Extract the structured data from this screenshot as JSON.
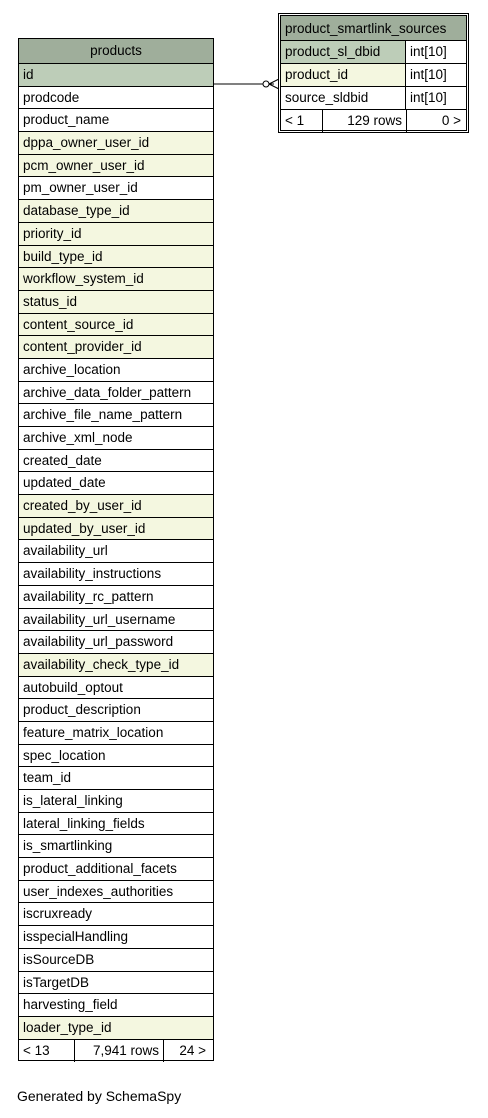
{
  "products": {
    "title": "products",
    "columns": [
      {
        "name": "id",
        "kind": "pk"
      },
      {
        "name": "prodcode",
        "kind": "plain"
      },
      {
        "name": "product_name",
        "kind": "plain"
      },
      {
        "name": "dppa_owner_user_id",
        "kind": "fk"
      },
      {
        "name": "pcm_owner_user_id",
        "kind": "fk"
      },
      {
        "name": "pm_owner_user_id",
        "kind": "plain"
      },
      {
        "name": "database_type_id",
        "kind": "fk"
      },
      {
        "name": "priority_id",
        "kind": "fk"
      },
      {
        "name": "build_type_id",
        "kind": "fk"
      },
      {
        "name": "workflow_system_id",
        "kind": "fk"
      },
      {
        "name": "status_id",
        "kind": "fk"
      },
      {
        "name": "content_source_id",
        "kind": "fk"
      },
      {
        "name": "content_provider_id",
        "kind": "fk"
      },
      {
        "name": "archive_location",
        "kind": "plain"
      },
      {
        "name": "archive_data_folder_pattern",
        "kind": "plain"
      },
      {
        "name": "archive_file_name_pattern",
        "kind": "plain"
      },
      {
        "name": "archive_xml_node",
        "kind": "plain"
      },
      {
        "name": "created_date",
        "kind": "plain"
      },
      {
        "name": "updated_date",
        "kind": "plain"
      },
      {
        "name": "created_by_user_id",
        "kind": "fk"
      },
      {
        "name": "updated_by_user_id",
        "kind": "fk"
      },
      {
        "name": "availability_url",
        "kind": "plain"
      },
      {
        "name": "availability_instructions",
        "kind": "plain"
      },
      {
        "name": "availability_rc_pattern",
        "kind": "plain"
      },
      {
        "name": "availability_url_username",
        "kind": "plain"
      },
      {
        "name": "availability_url_password",
        "kind": "plain"
      },
      {
        "name": "availability_check_type_id",
        "kind": "fk"
      },
      {
        "name": "autobuild_optout",
        "kind": "plain"
      },
      {
        "name": "product_description",
        "kind": "plain"
      },
      {
        "name": "feature_matrix_location",
        "kind": "plain"
      },
      {
        "name": "spec_location",
        "kind": "plain"
      },
      {
        "name": "team_id",
        "kind": "plain"
      },
      {
        "name": "is_lateral_linking",
        "kind": "plain"
      },
      {
        "name": "lateral_linking_fields",
        "kind": "plain"
      },
      {
        "name": "is_smartlinking",
        "kind": "plain"
      },
      {
        "name": "product_additional_facets",
        "kind": "plain"
      },
      {
        "name": "user_indexes_authorities",
        "kind": "plain"
      },
      {
        "name": "iscruxready",
        "kind": "plain"
      },
      {
        "name": "isspecialHandling",
        "kind": "plain"
      },
      {
        "name": "isSourceDB",
        "kind": "plain"
      },
      {
        "name": "isTargetDB",
        "kind": "plain"
      },
      {
        "name": "harvesting_field",
        "kind": "plain"
      },
      {
        "name": "loader_type_id",
        "kind": "fk"
      }
    ],
    "footer": {
      "parents": "< 13",
      "rows": "7,941 rows",
      "children": "24 >"
    }
  },
  "product_smartlink_sources": {
    "title": "product_smartlink_sources",
    "columns": [
      {
        "name": "product_sl_dbid",
        "type": "int[10]",
        "kind": "pk"
      },
      {
        "name": "product_id",
        "type": "int[10]",
        "kind": "fk"
      },
      {
        "name": "source_sldbid",
        "type": "int[10]",
        "kind": "plain"
      }
    ],
    "footer": {
      "parents": "< 1",
      "rows": "129 rows",
      "children": "0 >"
    }
  },
  "generated_by": "Generated by SchemaSpy",
  "colors": {
    "title_bg": "#9fae9b",
    "pk_bg": "#bdcdb8",
    "fk_bg": "#f4f7e0",
    "plain_bg": "#ffffff"
  },
  "relationship": {
    "from": "products.id",
    "to": "product_smartlink_sources.product_id"
  }
}
